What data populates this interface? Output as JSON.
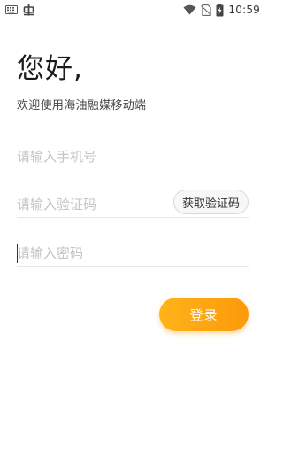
{
  "status_bar": {
    "time": "10:59",
    "icons": [
      "keyboard-icon",
      "bug-icon",
      "wifi-icon",
      "no-sim-icon",
      "battery-charging-icon"
    ]
  },
  "greeting": {
    "title": "您好,",
    "subtitle": "欢迎使用海油融媒移动端"
  },
  "form": {
    "phone_placeholder": "请输入手机号",
    "code_placeholder": "请输入验证码",
    "get_code_label": "获取验证码",
    "password_placeholder": "请输入密码",
    "login_label": "登录"
  },
  "colors": {
    "accent": "#fb9a0b",
    "accent_light": "#ffb31a",
    "placeholder": "#c4c4c4",
    "divider": "#e8e8e8"
  }
}
